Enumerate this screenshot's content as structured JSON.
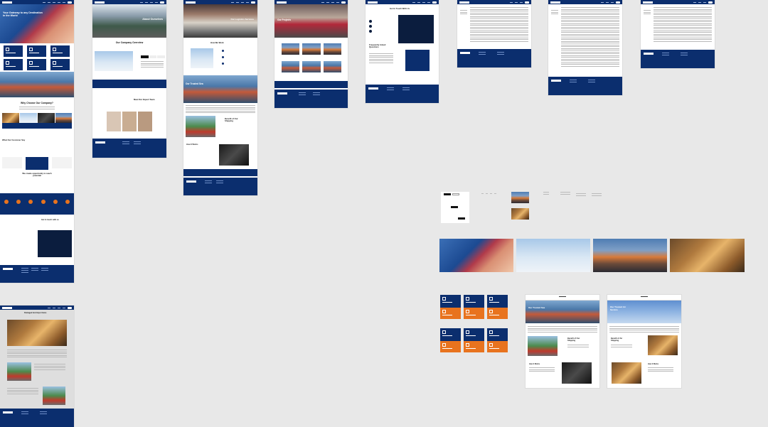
{
  "boards": {
    "home": {
      "hero_title": "Your Gateway to any Destination in the World",
      "why_title": "Why Choose Our Company?",
      "testimonials_title": "What Our Customer Say",
      "cta_title": "We create opportunity to reach potential",
      "contact_title": "Get in touch with us"
    },
    "about": {
      "hero_title": "About Ourselves",
      "overview_title": "Our Company Overview",
      "team_title": "Meet Our Expert Team"
    },
    "services": {
      "hero_title": "Our Logistics Services",
      "how_title": "How We Work",
      "banner_title": "Our Trusted Sea",
      "benefit_title": "Benefit of Our Shipping",
      "works_title": "How It Works"
    },
    "projects": {
      "hero_title": "Our Projects"
    },
    "contact": {
      "title": "Get In Touch With Us",
      "faq_title": "Frequently Asked Questions"
    },
    "warehouse": {
      "title": "Packaged And Import Items"
    },
    "sea": {
      "hero_title": "Our Trusted Sea",
      "benefit_title": "Benefit of Our Shipping",
      "works_title": "How It Works"
    },
    "air": {
      "hero_title": "Our Trusted Air Service",
      "benefit_title": "Benefit of Air Shipping",
      "works_title": "How It Works"
    }
  },
  "colors": {
    "brand_navy": "#0b2e6e",
    "accent_orange": "#e8731e",
    "canvas": "#e8e8e8"
  }
}
